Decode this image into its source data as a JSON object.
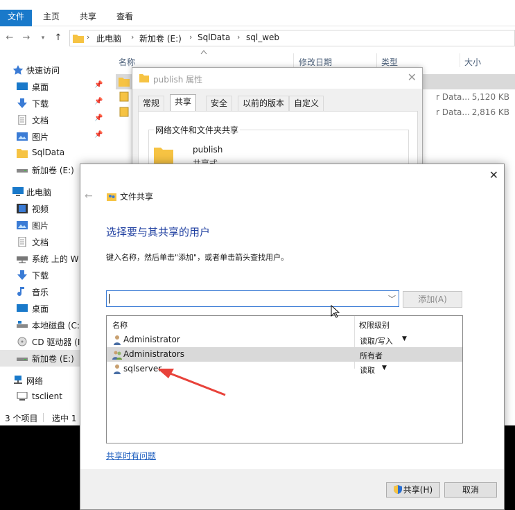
{
  "ribbon": {
    "tabs": [
      "文件",
      "主页",
      "共享",
      "查看"
    ]
  },
  "address": {
    "crumbs": [
      "此电脑",
      "新加卷 (E:)",
      "SqlData",
      "sql_web"
    ]
  },
  "nav": {
    "items": [
      {
        "label": "快速访问"
      },
      {
        "label": "桌面"
      },
      {
        "label": "下载"
      },
      {
        "label": "文档"
      },
      {
        "label": "图片"
      },
      {
        "label": "SqlData"
      },
      {
        "label": "新加卷 (E:)"
      },
      {
        "label": "此电脑"
      },
      {
        "label": "视频"
      },
      {
        "label": "图片"
      },
      {
        "label": "文档"
      },
      {
        "label": "系统 上的 W"
      },
      {
        "label": "下载"
      },
      {
        "label": "音乐"
      },
      {
        "label": "桌面"
      },
      {
        "label": "本地磁盘 (C:"
      },
      {
        "label": "CD 驱动器 (I"
      },
      {
        "label": "新加卷 (E:)"
      },
      {
        "label": "网络"
      },
      {
        "label": "tsclient"
      }
    ]
  },
  "filelist": {
    "columns": {
      "name": "名称",
      "modified": "修改日期",
      "type": "类型",
      "size": "大小"
    },
    "rows": [
      {
        "type": "",
        "size": ""
      },
      {
        "type": "r Data...",
        "size": "5,120 KB"
      },
      {
        "type": "r Data...",
        "size": "2,816 KB"
      }
    ]
  },
  "status": {
    "count": "3 个项目",
    "selected": "选中 1"
  },
  "props": {
    "title": "publish 属性",
    "tabs": [
      "常规",
      "共享",
      "安全",
      "以前的版本",
      "自定义"
    ],
    "group_label": "网络文件和文件夹共享",
    "folder_name": "publish",
    "folder_sub": "共享式"
  },
  "share_dialog": {
    "header": "文件共享",
    "heading": "选择要与其共享的用户",
    "instruction": "键入名称，然后单击\"添加\"，或者单击箭头查找用户。",
    "input_value": "",
    "add_label": "添加(A)",
    "col_name": "名称",
    "col_level": "权限级别",
    "entries": [
      {
        "name": "Administrator",
        "level": "读取/写入"
      },
      {
        "name": "Administrators",
        "level": "所有者"
      },
      {
        "name": "sqlserver",
        "level": "读取"
      }
    ],
    "help_link": "共享时有问题",
    "share_button": "共享(H)",
    "cancel_button": "取消"
  },
  "colors": {
    "accent": "#1979ca",
    "heading": "#1f3fa0",
    "annotation_arrow": "#e8423a"
  }
}
